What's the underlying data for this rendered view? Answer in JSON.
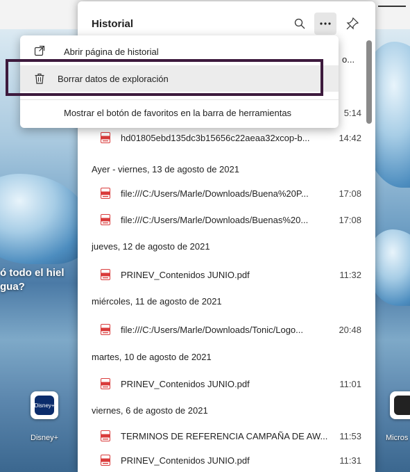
{
  "background": {
    "left_text_line1": "ó todo el hiel",
    "left_text_line2": "gua?",
    "left_tile_label": "Disney+",
    "left_tile_icon": "Disney+",
    "right_tile_label": "Micros"
  },
  "history": {
    "title": "Historial",
    "search_icon": "search-icon",
    "more_icon": "more-icon",
    "pin_icon": "pin-icon",
    "partial_top_right": "o...",
    "partial_time": "5:14",
    "entries": [
      {
        "title": "hd01805ebd135dc3b15656c22aeaa32xcop-b...",
        "time": "14:42"
      },
      {
        "date": "Ayer - viernes, 13 de agosto de 2021"
      },
      {
        "title": "file:///C:/Users/Marle/Downloads/Buena%20P...",
        "time": "17:08"
      },
      {
        "title": "file:///C:/Users/Marle/Downloads/Buenas%20...",
        "time": "17:08"
      },
      {
        "date": "jueves, 12 de agosto de 2021"
      },
      {
        "title": "PRINEV_Contenidos JUNIO.pdf",
        "time": "11:32"
      },
      {
        "date": "miércoles, 11 de agosto de 2021"
      },
      {
        "title": "file:///C:/Users/Marle/Downloads/Tonic/Logo...",
        "time": "20:48"
      },
      {
        "date": "martes, 10 de agosto de 2021"
      },
      {
        "title": "PRINEV_Contenidos JUNIO.pdf",
        "time": "11:01"
      },
      {
        "date": "viernes, 6 de agosto de 2021"
      },
      {
        "title": "TERMINOS DE REFERENCIA CAMPAÑA DE AW...",
        "time": "11:53"
      },
      {
        "title": "PRINEV_Contenidos JUNIO.pdf",
        "time": "11:31"
      }
    ]
  },
  "menu": {
    "items": [
      {
        "label": "Abrir página de historial",
        "icon": "open-external-icon"
      },
      {
        "label": "Borrar datos de exploración",
        "icon": "trash-icon"
      },
      {
        "label": "Mostrar el botón de favoritos en la barra de herramientas",
        "icon": ""
      }
    ]
  },
  "colors": {
    "highlight_border": "#3d1a3d",
    "pdf_icon": "#d93b3b",
    "menu_hover": "#ececec"
  }
}
